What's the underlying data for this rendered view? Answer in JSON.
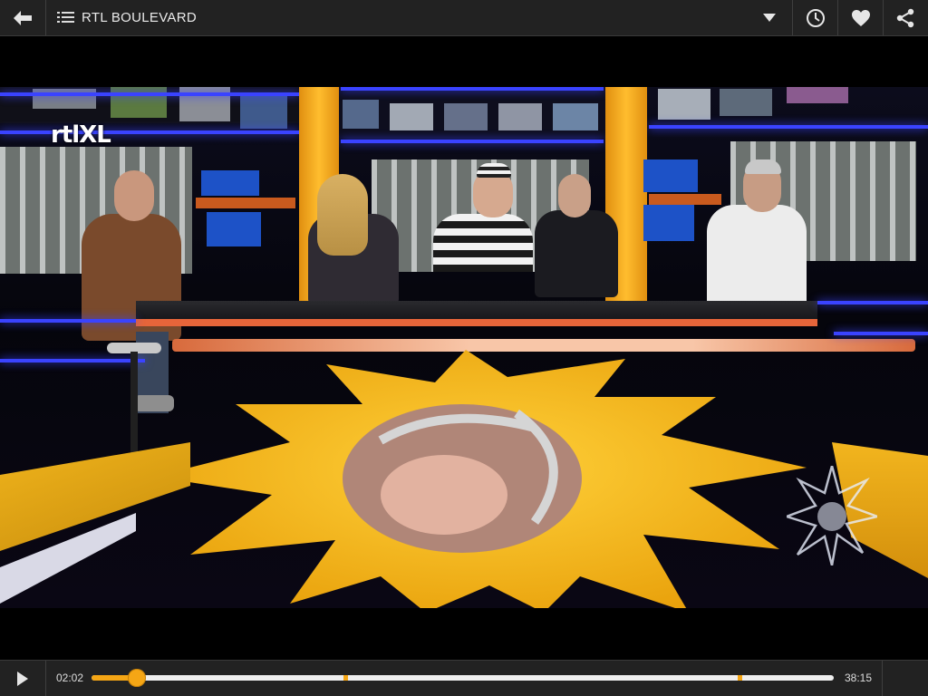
{
  "header": {
    "title": "RTL BOULEVARD"
  },
  "player": {
    "current_time": "02:02",
    "total_time": "38:15",
    "progress_fraction": 0.061,
    "chapter_markers": [
      0.34,
      0.87
    ],
    "accent_color": "#f5a615"
  },
  "video": {
    "channel_logo": "rtlXL"
  },
  "icons": {
    "back": "back-arrow-icon",
    "menu": "menu-list-icon",
    "dropdown": "chevron-down-icon",
    "watch_later": "clock-icon",
    "favorite": "heart-icon",
    "share": "share-icon",
    "play": "play-icon"
  }
}
